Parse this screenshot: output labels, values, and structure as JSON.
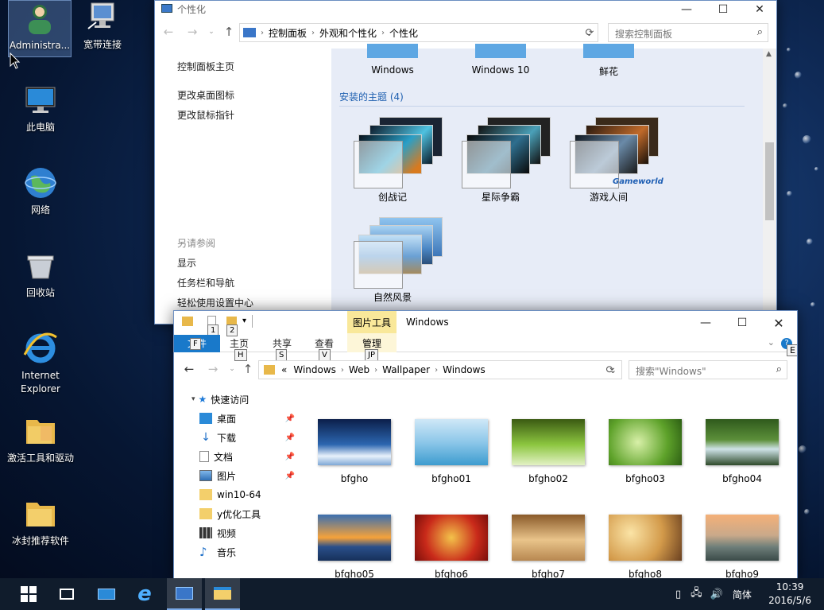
{
  "desktop": {
    "icons": [
      {
        "label": "Administra..."
      },
      {
        "label": "宽带连接"
      },
      {
        "label": "此电脑"
      },
      {
        "label": "网络"
      },
      {
        "label": "回收站"
      },
      {
        "label": "Internet Explorer"
      },
      {
        "label": "激活工具和驱动"
      },
      {
        "label": "冰封推荐软件"
      }
    ]
  },
  "control_panel": {
    "title": "个性化",
    "breadcrumb": [
      "控制面板",
      "外观和个性化",
      "个性化"
    ],
    "search_placeholder": "搜索控制面板",
    "sidebar": {
      "home": "控制面板主页",
      "links": [
        "更改桌面图标",
        "更改鼠标指针"
      ],
      "see_also_heading": "另请参阅",
      "see_also": [
        "显示",
        "任务栏和导航",
        "轻松使用设置中心"
      ]
    },
    "top_themes": [
      "Windows",
      "Windows 10",
      "鲜花"
    ],
    "installed_heading": "安装的主题 (4)",
    "installed_themes": [
      "创战记",
      "星际争霸",
      "游戏人间",
      "自然风景"
    ],
    "gameworld_watermark": "Gameworld"
  },
  "explorer": {
    "title": "Windows",
    "context_tab": "图片工具",
    "tabs": {
      "file": "文件",
      "home": "主页",
      "share": "共享",
      "view": "查看",
      "manage": "管理"
    },
    "keytips": {
      "qat1": "1",
      "qat2": "2",
      "file": "F",
      "home": "H",
      "share": "S",
      "view": "V",
      "manage": "JP",
      "help": "E"
    },
    "path": [
      "Windows",
      "Web",
      "Wallpaper",
      "Windows"
    ],
    "path_prefix": "«",
    "search_placeholder": "搜索\"Windows\"",
    "nav": {
      "quick_access": "快速访问",
      "items": [
        "桌面",
        "下载",
        "文档",
        "图片",
        "win10-64",
        "y优化工具",
        "视频",
        "音乐"
      ]
    },
    "files": [
      "bfgho",
      "bfgho01",
      "bfgho02",
      "bfgho03",
      "bfgho04",
      "bfgho05",
      "bfgho6",
      "bfgho7",
      "bfgho8",
      "bfgho9"
    ]
  },
  "taskbar": {
    "ime": "简体",
    "time": "10:39",
    "date": "2016/5/6"
  }
}
